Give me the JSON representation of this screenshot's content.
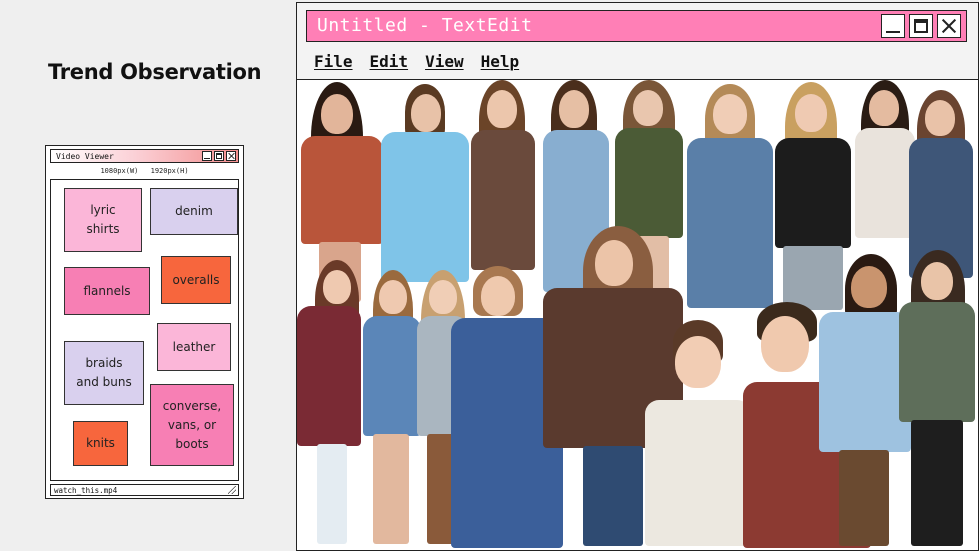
{
  "slide": {
    "title": "Trend Observation"
  },
  "video_viewer": {
    "title": "Video Viewer",
    "width_label": "1080px(W)",
    "height_label": "1920px(H)",
    "filename": "watch_this.mp4",
    "tags": [
      {
        "label": "lyric\nshirts",
        "color": "#fbb6d8"
      },
      {
        "label": "denim",
        "color": "#d9d0ee"
      },
      {
        "label": "flannels",
        "color": "#f77fb4"
      },
      {
        "label": "overalls",
        "color": "#f7663d"
      },
      {
        "label": "leather",
        "color": "#fbb6d8"
      },
      {
        "label": "braids\nand buns",
        "color": "#d9d0ee"
      },
      {
        "label": "converse,\nvans, or\nboots",
        "color": "#f77fb4"
      },
      {
        "label": "knits",
        "color": "#f7663d"
      }
    ]
  },
  "textedit": {
    "title": "Untitled - TextEdit",
    "menu": [
      "File",
      "Edit",
      "View",
      "Help"
    ],
    "title_bar_color": "#ff7fb6"
  },
  "collage": {
    "description_icon": "photo-collage-image"
  }
}
